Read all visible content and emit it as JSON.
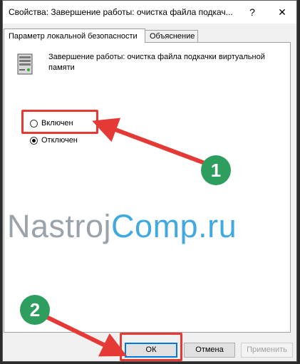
{
  "window": {
    "title": "Свойства: Завершение работы: очистка файла подкач...",
    "help_glyph": "?",
    "close_glyph": "✕"
  },
  "tabs": [
    {
      "label": "Параметр локальной безопасности",
      "active": true
    },
    {
      "label": "Объяснение",
      "active": false
    }
  ],
  "policy": {
    "icon": "server-icon",
    "description": "Завершение работы: очистка файла подкачки виртуальной памяти"
  },
  "options": [
    {
      "label": "Включен",
      "checked": false
    },
    {
      "label": "Отключен",
      "checked": true
    }
  ],
  "buttons": {
    "ok": "ОК",
    "cancel": "Отмена",
    "apply": "Применить"
  },
  "watermark": {
    "part1": "Nastroj",
    "part2": "Comp.ru"
  },
  "annotations": {
    "step1": "1",
    "step2": "2",
    "highlight_color": "#e53935",
    "badge_color": "#2e9e5f",
    "watermark_gray": "#9aa3aa",
    "watermark_blue": "#3fa9e0"
  }
}
